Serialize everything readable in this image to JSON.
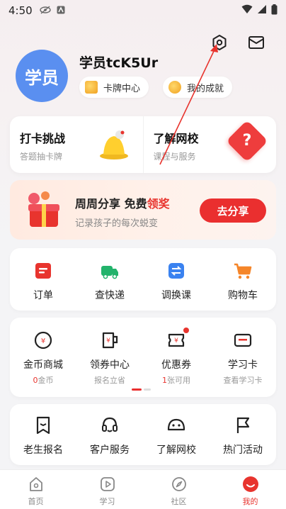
{
  "status_bar": {
    "time": "4:50"
  },
  "profile": {
    "avatar_text": "学员",
    "username": "学员tcK5Ur",
    "chips": [
      {
        "label": "卡牌中心",
        "icon": "card-icon"
      },
      {
        "label": "我的成就",
        "icon": "medal-icon"
      }
    ]
  },
  "quick_cards": [
    {
      "title": "打卡挑战",
      "subtitle": "答题抽卡牌",
      "icon": "bell-icon"
    },
    {
      "title": "了解网校",
      "subtitle": "课程与服务",
      "icon": "question-diamond-icon"
    }
  ],
  "promo": {
    "title_prefix": "周周分享 免费",
    "title_highlight": "领奖",
    "subtitle": "记录孩子的每次蜕变",
    "button": "去分享"
  },
  "orders_grid": [
    {
      "label": "订单",
      "icon": "order-icon",
      "color": "#e8342e"
    },
    {
      "label": "查快递",
      "icon": "truck-icon",
      "color": "#22b36b"
    },
    {
      "label": "调换课",
      "icon": "swap-icon",
      "color": "#3a82f0"
    },
    {
      "label": "购物车",
      "icon": "cart-icon",
      "color": "#f5862a"
    }
  ],
  "wallet_grid": [
    {
      "label": "金币商城",
      "sub_num": "0",
      "sub_text": "金币",
      "icon": "coin-icon"
    },
    {
      "label": "领券中心",
      "sub_num": "",
      "sub_text": "报名立省",
      "icon": "coupon-cup-icon"
    },
    {
      "label": "优惠券",
      "sub_num": "1",
      "sub_text": "张可用",
      "icon": "ticket-icon"
    },
    {
      "label": "学习卡",
      "sub_num": "",
      "sub_text": "查看学习卡",
      "icon": "study-card-icon"
    }
  ],
  "services_grid": [
    {
      "label": "老生报名",
      "icon": "bookmark-icon"
    },
    {
      "label": "客户服务",
      "icon": "headset-icon"
    },
    {
      "label": "了解网校",
      "icon": "face-icon"
    },
    {
      "label": "热门活动",
      "icon": "flag-icon"
    }
  ],
  "tabbar": [
    {
      "label": "首页",
      "icon": "home-icon",
      "active": false
    },
    {
      "label": "学习",
      "icon": "play-icon",
      "active": false
    },
    {
      "label": "社区",
      "icon": "compass-icon",
      "active": false
    },
    {
      "label": "我的",
      "icon": "me-icon",
      "active": true
    }
  ],
  "colors": {
    "accent": "#ea2f2f",
    "avatar": "#5a8ff0"
  }
}
